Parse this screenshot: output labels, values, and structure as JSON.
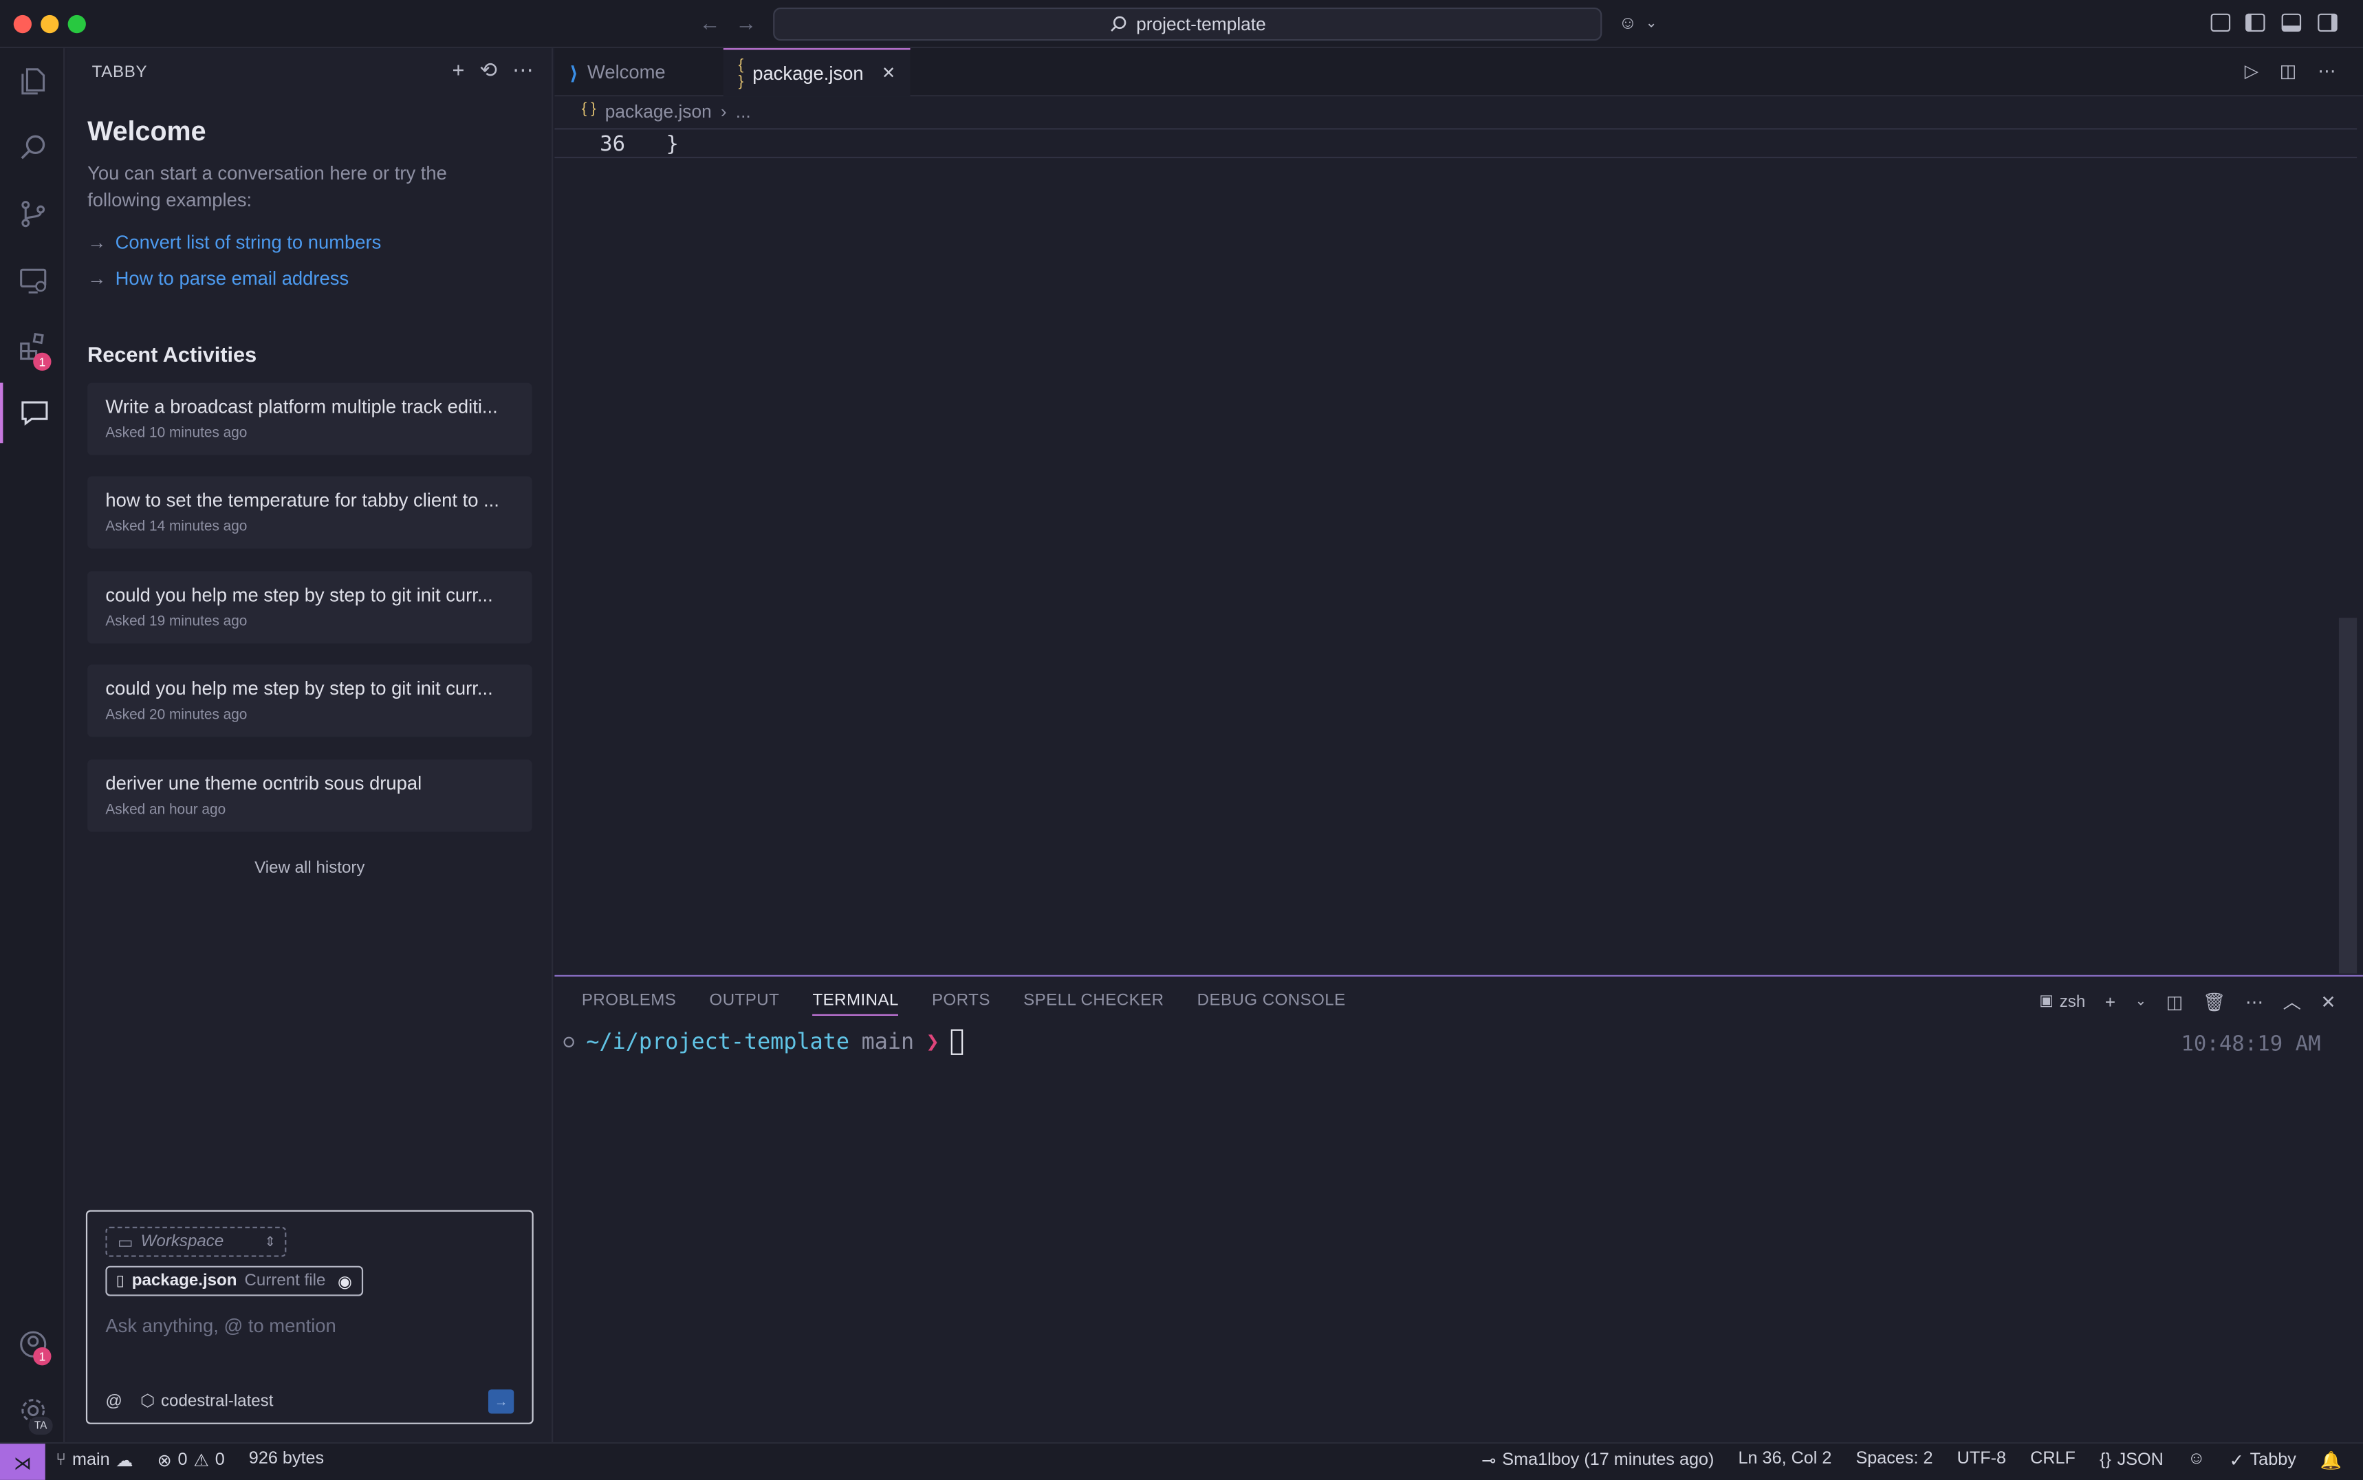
{
  "titlebar": {
    "search_text": "project-template"
  },
  "activity_bar": {
    "extensions_badge": "1",
    "accounts_badge": "1",
    "manage_label": "TA"
  },
  "sidebar": {
    "header": "TABBY",
    "welcome_title": "Welcome",
    "welcome_sub": "You can start a conversation here or try the following examples:",
    "examples": [
      "Convert list of string to numbers",
      "How to parse email address"
    ],
    "recent_title": "Recent Activities",
    "activities": [
      {
        "title": "Write a broadcast platform multiple track editi...",
        "time": "Asked 10 minutes ago"
      },
      {
        "title": "how to set the temperature for tabby client to ...",
        "time": "Asked 14 minutes ago"
      },
      {
        "title": "could you help me step by step to git init curr...",
        "time": "Asked 19 minutes ago"
      },
      {
        "title": "could you help me step by step to git init curr...",
        "time": "Asked 20 minutes ago"
      },
      {
        "title": "deriver une theme ocntrib sous drupal",
        "time": "Asked an hour ago"
      }
    ],
    "view_all": "View all history",
    "chat": {
      "workspace": "Workspace",
      "file_name": "package.json",
      "file_tag": "Current file",
      "placeholder": "Ask anything, @ to mention",
      "mention": "@",
      "model": "codestral-latest"
    }
  },
  "editor": {
    "tabs": [
      {
        "label": "Welcome"
      },
      {
        "label": "package.json"
      }
    ],
    "breadcrumb": [
      "package.json",
      "..."
    ],
    "line_number": "36",
    "line_text": "}"
  },
  "panel": {
    "tabs": [
      "PROBLEMS",
      "OUTPUT",
      "TERMINAL",
      "PORTS",
      "SPELL CHECKER",
      "DEBUG CONSOLE"
    ],
    "shell": "zsh",
    "term_path": "~/i/project-template",
    "term_branch": "main",
    "term_prompt": "❯",
    "term_time": "10:48:19 AM"
  },
  "statusbar": {
    "branch": "main",
    "errors": "0",
    "warnings": "0",
    "size": "926 bytes",
    "blame": "Sma1lboy (17 minutes ago)",
    "position": "Ln 36, Col 2",
    "spaces": "Spaces: 2",
    "encoding": "UTF-8",
    "eol": "CRLF",
    "language": "JSON",
    "tabby": "Tabby"
  }
}
